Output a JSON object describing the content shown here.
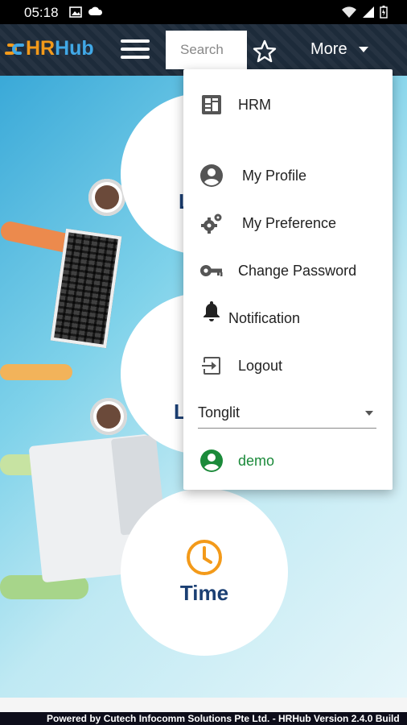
{
  "status_bar": {
    "time": "05:18"
  },
  "header": {
    "logo_hr": "HR",
    "logo_hub": "Hub",
    "search_placeholder": "Search",
    "more_label": "More"
  },
  "menu": {
    "items": [
      {
        "label": "HRM",
        "icon": "dashboard-icon"
      },
      {
        "label": "My Profile",
        "icon": "account-circle-icon"
      },
      {
        "label": "My Preference",
        "icon": "gears-icon"
      },
      {
        "label": "Change Password",
        "icon": "key-icon"
      },
      {
        "label": "Notification",
        "icon": "bell-icon"
      },
      {
        "label": "Logout",
        "icon": "logout-icon"
      }
    ],
    "company_select": "Tonglit",
    "user": "demo"
  },
  "main": {
    "time_label": "Time"
  },
  "footer": {
    "text": "Powered by Cutech Infocomm Solutions Pte Ltd. - HRHub Version 2.4.0 Build"
  },
  "colors": {
    "accent_orange": "#f39a1a",
    "accent_blue": "#41a8e6",
    "user_green": "#1b8a3a",
    "title_navy": "#1b3f73"
  }
}
